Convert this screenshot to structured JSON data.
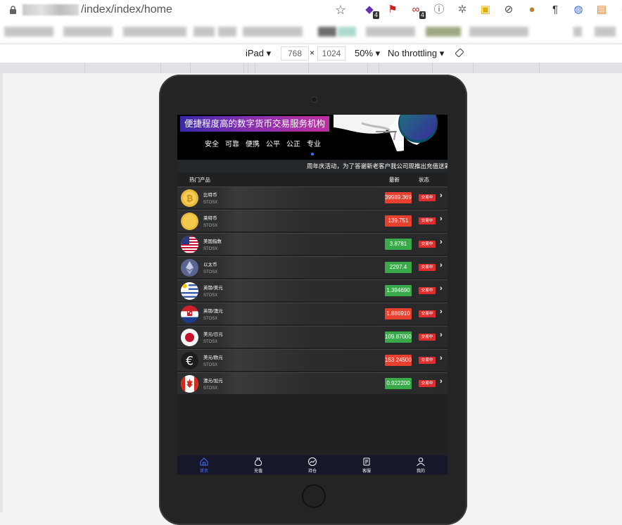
{
  "browser": {
    "url_path": "/index/index/home",
    "extensions": [
      {
        "icon": "cube-extension-icon",
        "badge": "4"
      },
      {
        "icon": "flag-extension-icon",
        "badge": ""
      },
      {
        "icon": "link-extension-icon",
        "badge": "4"
      },
      {
        "icon": "ip-extension-icon",
        "badge": ""
      },
      {
        "icon": "gear-extension-icon",
        "badge": ""
      },
      {
        "icon": "js-extension-icon",
        "badge": ""
      },
      {
        "icon": "block-extension-icon",
        "badge": ""
      },
      {
        "icon": "cookie-extension-icon",
        "badge": ""
      },
      {
        "icon": "pilcrow-extension-icon",
        "badge": ""
      },
      {
        "icon": "globe-extension-icon",
        "badge": ""
      },
      {
        "icon": "ip-orange-extension-icon",
        "badge": ""
      },
      {
        "icon": "evernote-extension-icon",
        "badge": ""
      }
    ]
  },
  "devtools": {
    "device": "iPad",
    "width": "768",
    "times": "×",
    "height": "1024",
    "zoom": "50%",
    "throttling": "No throttling"
  },
  "app": {
    "banner_title": "便捷程度高的数字货币交易服务机构",
    "banner_tags": [
      "安全",
      "可靠",
      "便携",
      "公平",
      "公正",
      "专业"
    ],
    "marquee": "周年庆活动，为了答谢新老客户我公司现推出充值送彩金",
    "columns": {
      "product": "热门产品",
      "latest": "最新",
      "status": "状态"
    },
    "rows": [
      {
        "name": "比特币",
        "sub": "STOSX",
        "price": "39989.3699",
        "trend": "down",
        "status": "交易中",
        "coin": "bitcoin"
      },
      {
        "name": "莱特币",
        "sub": "STOSX",
        "price": "139.751",
        "trend": "down",
        "status": "交易中",
        "coin": "litecoin"
      },
      {
        "name": "美国指数",
        "sub": "STOSX",
        "price": "3.8781",
        "trend": "up",
        "status": "交易中",
        "coin": "usa"
      },
      {
        "name": "以太币",
        "sub": "STOSX",
        "price": "2297.4",
        "trend": "up",
        "status": "交易中",
        "coin": "ethereum"
      },
      {
        "name": "英镑/美元",
        "sub": "STOSX",
        "price": "1.394690",
        "trend": "up",
        "status": "交易中",
        "coin": "uruguay"
      },
      {
        "name": "英镑/澳元",
        "sub": "STOSX",
        "price": "1.886910",
        "trend": "down",
        "status": "交易中",
        "coin": "croatia"
      },
      {
        "name": "美元/日元",
        "sub": "STOSX",
        "price": "109.870000",
        "trend": "up",
        "status": "交易中",
        "coin": "japan"
      },
      {
        "name": "美元/欧元",
        "sub": "STOSX",
        "price": "153.245000",
        "trend": "down",
        "status": "交易中",
        "coin": "euro"
      },
      {
        "name": "澳元/加元",
        "sub": "STOSX",
        "price": "0.922200",
        "trend": "up",
        "status": "交易中",
        "coin": "canada"
      }
    ],
    "nav": [
      {
        "label": "首页",
        "icon": "home-icon",
        "active": true
      },
      {
        "label": "充值",
        "icon": "money-bag-icon",
        "active": false
      },
      {
        "label": "持仓",
        "icon": "chart-icon",
        "active": false
      },
      {
        "label": "客服",
        "icon": "service-icon",
        "active": false
      },
      {
        "label": "我的",
        "icon": "user-icon",
        "active": false
      }
    ],
    "colors": {
      "up": "#3aa94a",
      "down": "#e8402e",
      "status": "#e02e2e",
      "accent": "#4a6cff"
    }
  }
}
